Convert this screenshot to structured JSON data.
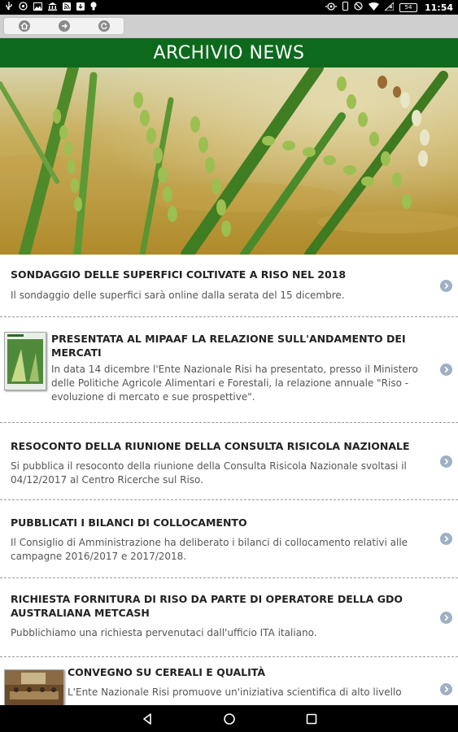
{
  "status_bar": {
    "time": "11:54",
    "battery_label": "54",
    "left_icons": [
      "usb-icon",
      "at-icon",
      "gallery-icon",
      "bank-icon",
      "rss-icon",
      "download-icon",
      "bulb-icon"
    ],
    "right_icons": [
      "cast-icon",
      "phone-icon",
      "do-not-disturb-icon",
      "wifi-icon",
      "no-signal-icon",
      "battery-icon"
    ]
  },
  "toolbar": {
    "buttons": [
      "home-icon",
      "forward-icon",
      "refresh-icon"
    ]
  },
  "header": {
    "title": "ARCHIVIO NEWS"
  },
  "colors": {
    "header_bg": "#0d6a1d",
    "chevron": "#9eb0c4"
  },
  "news": [
    {
      "title": "SONDAGGIO DELLE SUPERFICI COLTIVATE A RISO NEL 2018",
      "text": "Il sondaggio delle superfici sarà online dalla serata del 15 dicembre."
    },
    {
      "title": "PRESENTATA AL MIPAAF LA RELAZIONE SULL'ANDAMENTO DEI MERCATI",
      "text": "In data 14 dicembre l'Ente Nazionale Risi ha presentato, presso il Ministero delle Politiche Agricole Alimentari e Forestali, la relazione annuale \"Riso - evoluzione di mercato e sue prospettive\"."
    },
    {
      "title": "RESOCONTO DELLA RIUNIONE DELLA CONSULTA RISICOLA NAZIONALE",
      "text": "Si pubblica il resoconto della riunione della Consulta Risicola Nazionale svoltasi il 04/12/2017 al Centro Ricerche sul Riso."
    },
    {
      "title": "PUBBLICATI I BILANCI DI COLLOCAMENTO",
      "text": "Il Consiglio di Amministrazione ha deliberato i bilanci di collocamento relativi alle campagne 2016/2017 e 2017/2018."
    },
    {
      "title": "RICHIESTA FORNITURA DI RISO DA PARTE DI OPERATORE DELLA GDO AUSTRALIANA METCASH",
      "text": "Pubblichiamo una richiesta pervenutaci dall'ufficio ITA italiano."
    },
    {
      "title": "CONVEGNO SU CEREALI E QUALITÀ",
      "text": "L'Ente Nazionale Risi promuove un'iniziativa scientifica di alto livello"
    }
  ],
  "nav_bar": {
    "buttons": [
      "back-icon",
      "home-icon",
      "recents-icon"
    ]
  }
}
